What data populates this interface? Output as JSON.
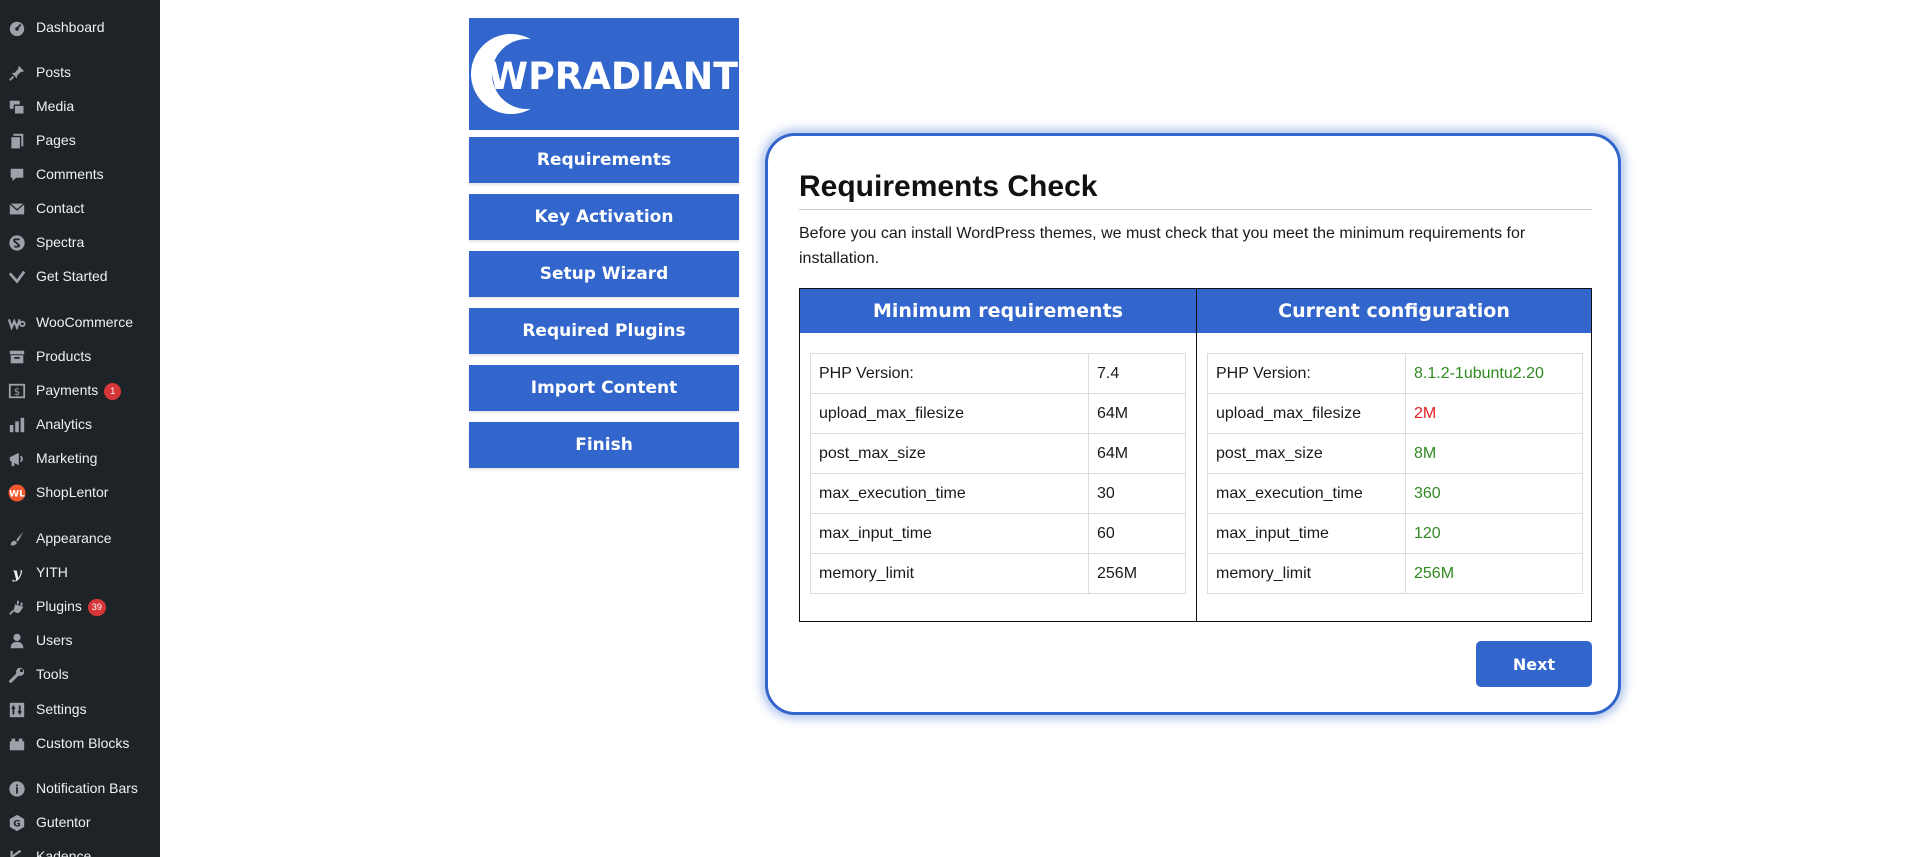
{
  "sidebar": {
    "items": [
      {
        "label": "Dashboard",
        "icon": "dashboard-icon"
      },
      {
        "label": "Posts",
        "icon": "pin-icon"
      },
      {
        "label": "Media",
        "icon": "media-icon"
      },
      {
        "label": "Pages",
        "icon": "pages-icon"
      },
      {
        "label": "Comments",
        "icon": "comment-icon"
      },
      {
        "label": "Contact",
        "icon": "mail-icon"
      },
      {
        "label": "Spectra",
        "icon": "spectra-icon"
      },
      {
        "label": "Get Started",
        "icon": "check-chevron-icon"
      },
      {
        "label": "WooCommerce",
        "icon": "woocommerce-icon"
      },
      {
        "label": "Products",
        "icon": "archive-icon"
      },
      {
        "label": "Payments",
        "icon": "payments-icon",
        "badge": "1"
      },
      {
        "label": "Analytics",
        "icon": "bar-chart-icon"
      },
      {
        "label": "Marketing",
        "icon": "megaphone-icon"
      },
      {
        "label": "ShopLentor",
        "icon": "shoplentor-icon"
      },
      {
        "label": "Appearance",
        "icon": "paintbrush-icon"
      },
      {
        "label": "YITH",
        "icon": "yith-icon"
      },
      {
        "label": "Plugins",
        "icon": "plug-icon",
        "badge": "39"
      },
      {
        "label": "Users",
        "icon": "user-icon"
      },
      {
        "label": "Tools",
        "icon": "wrench-icon"
      },
      {
        "label": "Settings",
        "icon": "settings-icon"
      },
      {
        "label": "Custom Blocks",
        "icon": "blocks-icon"
      },
      {
        "label": "Notification Bars",
        "icon": "info-icon"
      },
      {
        "label": "Gutentor",
        "icon": "gutentor-icon"
      },
      {
        "label": "Kadence",
        "icon": "kadence-icon"
      }
    ]
  },
  "logo": {
    "text": "WPRADIANT"
  },
  "steps": [
    "Requirements",
    "Key Activation",
    "Setup Wizard",
    "Required Plugins",
    "Import Content",
    "Finish"
  ],
  "card": {
    "title": "Requirements Check",
    "intro": "Before you can install WordPress themes, we must check that you meet the minimum requirements for installation.",
    "minimum": {
      "header": "Minimum requirements",
      "rows": [
        {
          "key": "PHP Version:",
          "value": "7.4"
        },
        {
          "key": "upload_max_filesize",
          "value": "64M"
        },
        {
          "key": "post_max_size",
          "value": "64M"
        },
        {
          "key": "max_execution_time",
          "value": "30"
        },
        {
          "key": "max_input_time",
          "value": "60"
        },
        {
          "key": "memory_limit",
          "value": "256M"
        }
      ]
    },
    "current": {
      "header": "Current configuration",
      "rows": [
        {
          "key": "PHP Version:",
          "value": "8.1.2-1ubuntu2.20",
          "status": "ok"
        },
        {
          "key": "upload_max_filesize",
          "value": "2M",
          "status": "fail"
        },
        {
          "key": "post_max_size",
          "value": "8M",
          "status": "ok"
        },
        {
          "key": "max_execution_time",
          "value": "360",
          "status": "ok"
        },
        {
          "key": "max_input_time",
          "value": "120",
          "status": "ok"
        },
        {
          "key": "memory_limit",
          "value": "256M",
          "status": "ok"
        }
      ]
    },
    "next_label": "Next"
  },
  "colors": {
    "sidebar_bg": "#1d2327",
    "accent_blue": "#3366cc",
    "ok_green": "#2f8a1f",
    "fail_red": "#e0201f",
    "badge_red": "#d63638"
  }
}
